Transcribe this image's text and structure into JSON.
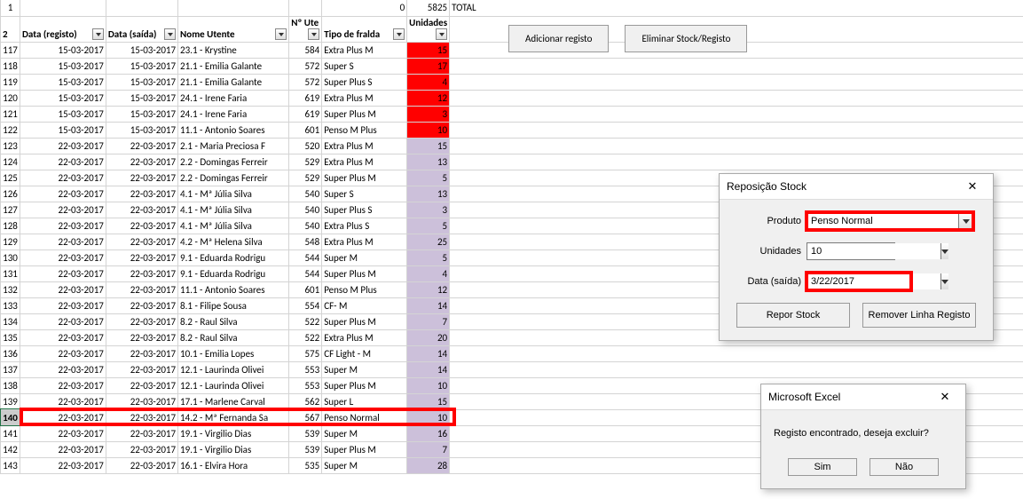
{
  "top": {
    "zero": "0",
    "total_num": "5825",
    "total_label": "TOTAL"
  },
  "buttons": {
    "add": "Adicionar registo",
    "del": "Eliminar Stock/Registo"
  },
  "headers": {
    "data_reg": "Data (registo)",
    "data_sai": "Data (saída)",
    "nome": "Nome Utente",
    "nute": "Nº Ute",
    "tipo": "Tipo de fralda",
    "uni": "Unidades"
  },
  "rows": [
    {
      "n": 117,
      "d1": "15-03-2017",
      "d2": "15-03-2017",
      "nome": "23.1 - Krystine",
      "ute": 584,
      "tipo": "Extra Plus M",
      "uni": 15,
      "c": "red"
    },
    {
      "n": 118,
      "d1": "15-03-2017",
      "d2": "15-03-2017",
      "nome": "21.1 - Emilia Galante",
      "ute": 572,
      "tipo": "Super S",
      "uni": 17,
      "c": "red"
    },
    {
      "n": 119,
      "d1": "15-03-2017",
      "d2": "15-03-2017",
      "nome": "21.1 - Emilia Galante",
      "ute": 572,
      "tipo": "Super Plus S",
      "uni": 4,
      "c": "red"
    },
    {
      "n": 120,
      "d1": "15-03-2017",
      "d2": "15-03-2017",
      "nome": "24.1 - Irene Faria",
      "ute": 619,
      "tipo": "Extra Plus M",
      "uni": 12,
      "c": "red"
    },
    {
      "n": 121,
      "d1": "15-03-2017",
      "d2": "15-03-2017",
      "nome": "24.1 - Irene Faria",
      "ute": 619,
      "tipo": "Super Plus M",
      "uni": 3,
      "c": "red"
    },
    {
      "n": 122,
      "d1": "15-03-2017",
      "d2": "15-03-2017",
      "nome": "11.1 - Antonio Soares",
      "ute": 601,
      "tipo": "Penso M Plus",
      "uni": 10,
      "c": "red"
    },
    {
      "n": 123,
      "d1": "22-03-2017",
      "d2": "22-03-2017",
      "nome": "2.1 - Maria Preciosa F",
      "ute": 520,
      "tipo": "Extra Plus  M",
      "uni": 15,
      "c": "purple"
    },
    {
      "n": 124,
      "d1": "22-03-2017",
      "d2": "22-03-2017",
      "nome": "2.2 - Domingas Ferreir",
      "ute": 529,
      "tipo": "Extra Plus  M",
      "uni": 13,
      "c": "purple"
    },
    {
      "n": 125,
      "d1": "22-03-2017",
      "d2": "22-03-2017",
      "nome": "2.2 - Domingas Ferreir",
      "ute": 529,
      "tipo": "Super Plus M",
      "uni": 5,
      "c": "purple"
    },
    {
      "n": 126,
      "d1": "22-03-2017",
      "d2": "22-03-2017",
      "nome": "4.1 - Mª Júlia Silva",
      "ute": 540,
      "tipo": "Super  S",
      "uni": 13,
      "c": "purple"
    },
    {
      "n": 127,
      "d1": "22-03-2017",
      "d2": "22-03-2017",
      "nome": "4.1 - Mª Júlia Silva",
      "ute": 540,
      "tipo": "Super Plus S",
      "uni": 3,
      "c": "purple"
    },
    {
      "n": 128,
      "d1": "22-03-2017",
      "d2": "22-03-2017",
      "nome": "4.1 - Mª Júlia Silva",
      "ute": 540,
      "tipo": "Extra Plus  S",
      "uni": 5,
      "c": "purple"
    },
    {
      "n": 129,
      "d1": "22-03-2017",
      "d2": "22-03-2017",
      "nome": "4.2 - Mª Helena Silva",
      "ute": 548,
      "tipo": "Extra Plus  M",
      "uni": 25,
      "c": "purple"
    },
    {
      "n": 130,
      "d1": "22-03-2017",
      "d2": "22-03-2017",
      "nome": "9.1 - Eduarda Rodrigu",
      "ute": 544,
      "tipo": "Super M",
      "uni": 5,
      "c": "purple"
    },
    {
      "n": 131,
      "d1": "22-03-2017",
      "d2": "22-03-2017",
      "nome": "9.1 - Eduarda Rodrigu",
      "ute": 544,
      "tipo": "Super Plus M",
      "uni": 4,
      "c": "purple"
    },
    {
      "n": 132,
      "d1": "22-03-2017",
      "d2": "22-03-2017",
      "nome": "11.1 - Antonio Soares",
      "ute": 601,
      "tipo": "Penso M Plus",
      "uni": 12,
      "c": "purple"
    },
    {
      "n": 133,
      "d1": "22-03-2017",
      "d2": "22-03-2017",
      "nome": "8.1 - Filipe Sousa",
      "ute": 554,
      "tipo": "CF- M",
      "uni": 14,
      "c": "purple"
    },
    {
      "n": 134,
      "d1": "22-03-2017",
      "d2": "22-03-2017",
      "nome": "8.2 - Raul Silva",
      "ute": 522,
      "tipo": "Super Plus M",
      "uni": 7,
      "c": "purple"
    },
    {
      "n": 135,
      "d1": "22-03-2017",
      "d2": "22-03-2017",
      "nome": "8.2 - Raul Silva",
      "ute": 522,
      "tipo": "Extra Plus  M",
      "uni": 20,
      "c": "purple"
    },
    {
      "n": 136,
      "d1": "22-03-2017",
      "d2": "22-03-2017",
      "nome": "10.1 - Emilia Lopes",
      "ute": 575,
      "tipo": "CF Light - M",
      "uni": 14,
      "c": "purple"
    },
    {
      "n": 137,
      "d1": "22-03-2017",
      "d2": "22-03-2017",
      "nome": "12.1 - Laurinda Olivei",
      "ute": 553,
      "tipo": "Super M",
      "uni": 14,
      "c": "purple"
    },
    {
      "n": 138,
      "d1": "22-03-2017",
      "d2": "22-03-2017",
      "nome": "12.1 - Laurinda Olivei",
      "ute": 553,
      "tipo": "Super Plus M",
      "uni": 10,
      "c": "purple"
    },
    {
      "n": 139,
      "d1": "22-03-2017",
      "d2": "22-03-2017",
      "nome": "17.1 - Marlene Carval",
      "ute": 562,
      "tipo": "Super L",
      "uni": 15,
      "c": "purple"
    },
    {
      "n": 140,
      "d1": "22-03-2017",
      "d2": "22-03-2017",
      "nome": "14.2 - Mª Fernanda Sa",
      "ute": 567,
      "tipo": "Penso Normal",
      "uni": 10,
      "c": "purple",
      "sel": true
    },
    {
      "n": 141,
      "d1": "22-03-2017",
      "d2": "22-03-2017",
      "nome": "19.1 - Virgilio Dias",
      "ute": 539,
      "tipo": "Super M",
      "uni": 16,
      "c": "purple"
    },
    {
      "n": 142,
      "d1": "22-03-2017",
      "d2": "22-03-2017",
      "nome": "19.1 - Virgilio Dias",
      "ute": 539,
      "tipo": "Super Plus M",
      "uni": 7,
      "c": "purple"
    },
    {
      "n": 143,
      "d1": "22-03-2017",
      "d2": "22-03-2017",
      "nome": "16.1 - Elvira Hora",
      "ute": 535,
      "tipo": "Super M",
      "uni": 28,
      "c": "purple"
    }
  ],
  "dialog1": {
    "title": "Reposição Stock",
    "produto_label": "Produto",
    "produto_value": "Penso Normal",
    "unidades_label": "Unidades",
    "unidades_value": "10",
    "data_label": "Data (saída)",
    "data_value": "3/22/2017",
    "btn_repor": "Repor Stock",
    "btn_remover": "Remover Linha Registo"
  },
  "dialog2": {
    "title": "Microsoft Excel",
    "msg": "Registo encontrado, deseja excluir?",
    "yes": "Sim",
    "no": "Não"
  }
}
